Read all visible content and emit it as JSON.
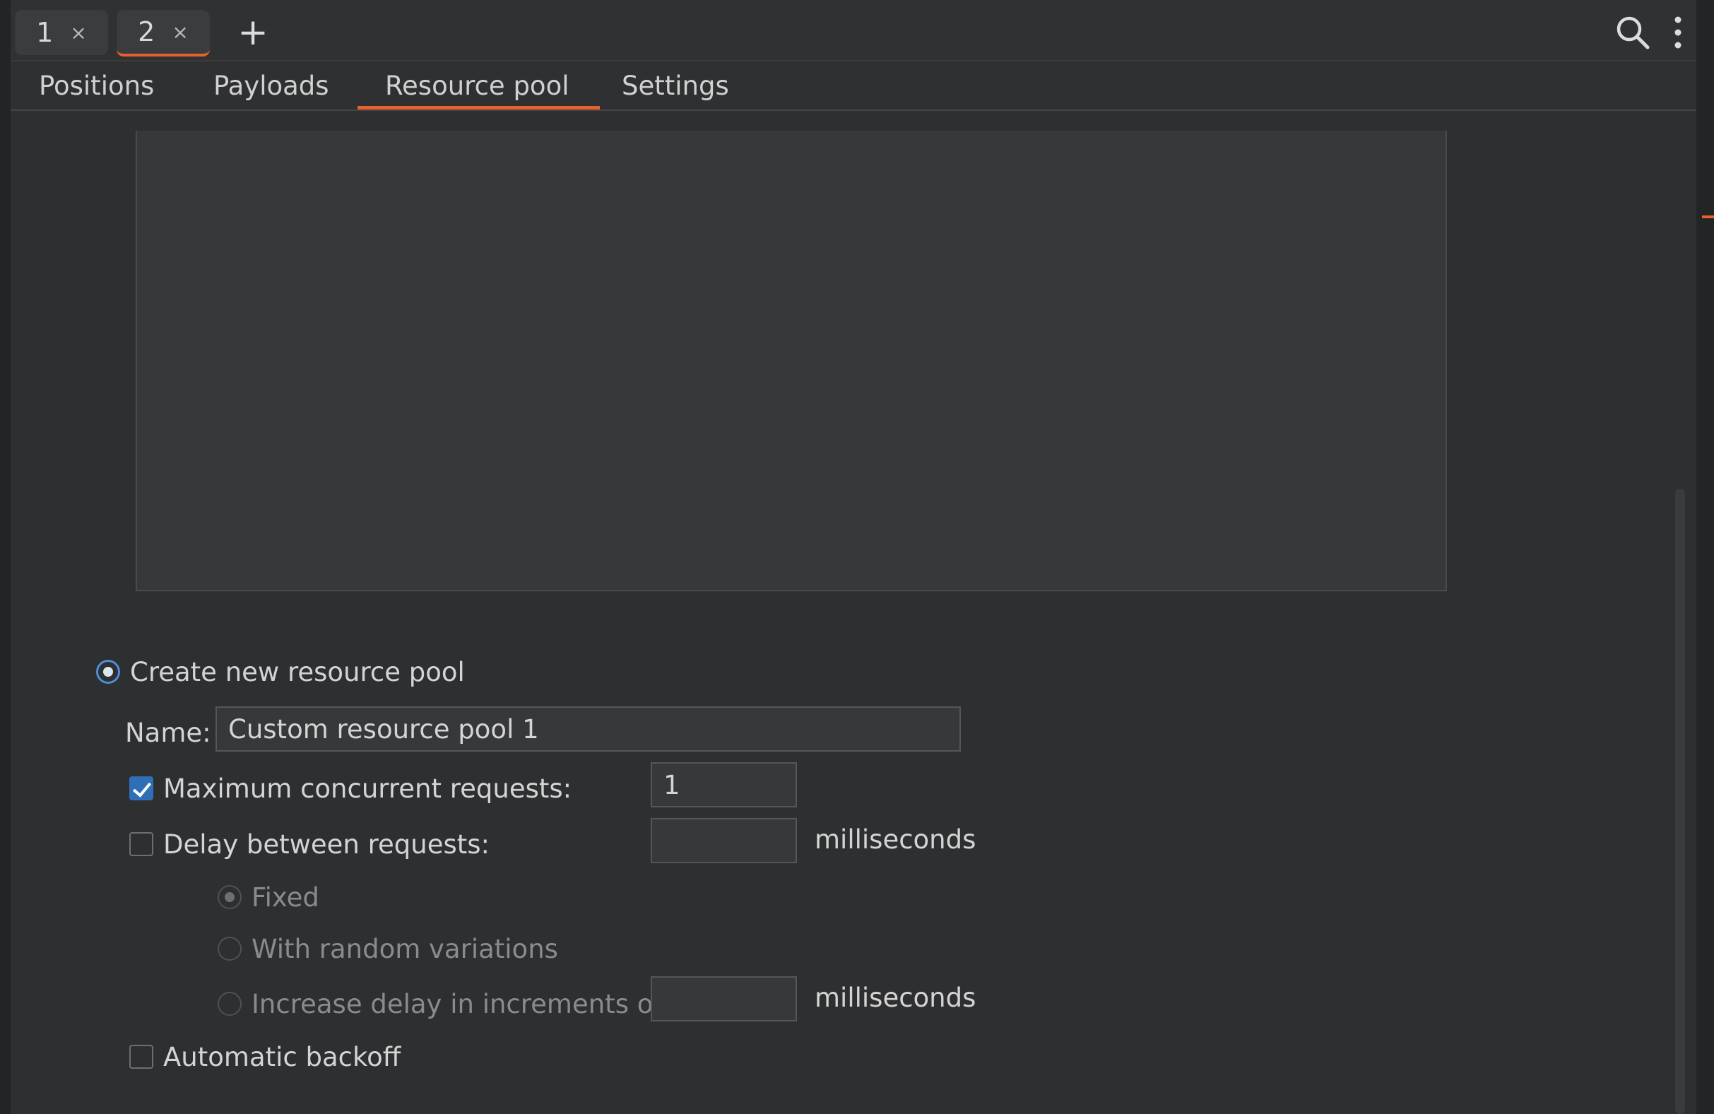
{
  "instance_tabs": [
    {
      "label": "1",
      "close": "×"
    },
    {
      "label": "2",
      "close": "×"
    }
  ],
  "add_tab": "+",
  "sub_tabs": [
    "Positions",
    "Payloads",
    "Resource pool",
    "Settings"
  ],
  "active_sub_tab": "Resource pool",
  "form": {
    "create_new_label": "Create new resource pool",
    "name_label": "Name:",
    "name_value": "Custom resource pool 1",
    "max_concurrent_label": "Maximum concurrent requests:",
    "max_concurrent_value": "1",
    "max_concurrent_checked": true,
    "delay_label": "Delay between requests:",
    "delay_value": "",
    "delay_checked": false,
    "milliseconds": "milliseconds",
    "fixed_label": "Fixed",
    "random_label": "With random variations",
    "increase_label": "Increase delay in increments of",
    "increase_value": "",
    "auto_backoff_label": "Automatic backoff",
    "auto_backoff_checked": false
  },
  "colors": {
    "accent": "#e8612c",
    "checkbox_blue": "#2f6fb8",
    "radio_blue": "#4c8fd6"
  },
  "icons": {
    "search": "search-icon",
    "more": "more-vert-icon",
    "close": "close-icon",
    "add": "plus-icon"
  }
}
